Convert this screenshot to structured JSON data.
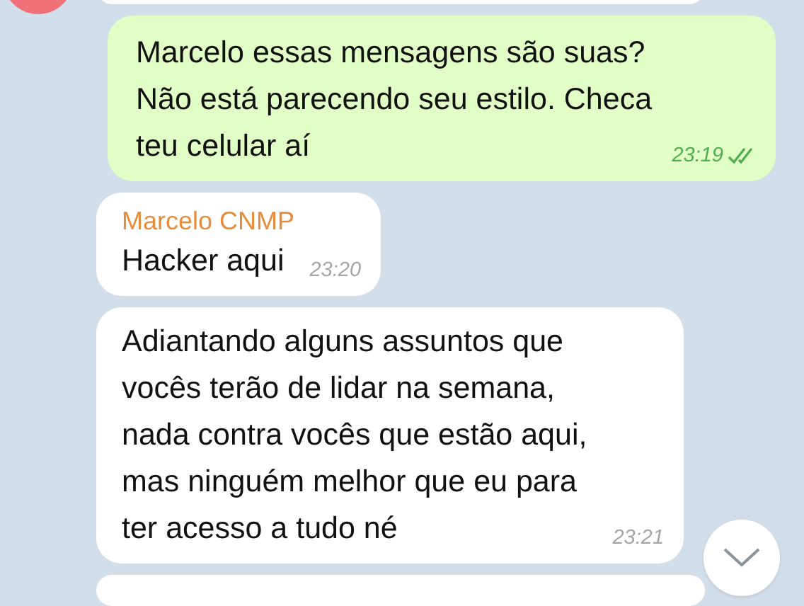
{
  "messages": [
    {
      "kind": "partial"
    },
    {
      "kind": "outgoing",
      "text": "Marcelo essas mensagens são suas?\nNão está parecendo seu estilo. Checa\nteu celular aí",
      "time": "23:19",
      "read": true
    },
    {
      "kind": "incoming",
      "sender": "Marcelo CNMP",
      "text": "Hacker aqui",
      "time": "23:20"
    },
    {
      "kind": "incoming",
      "text": "Adiantando alguns assuntos que\nvocês terão de lidar na semana,\nnada contra vocês que estão aqui,\nmas ninguém melhor que eu para\nter acesso a tudo né",
      "time": "23:21"
    },
    {
      "kind": "partial"
    }
  ]
}
